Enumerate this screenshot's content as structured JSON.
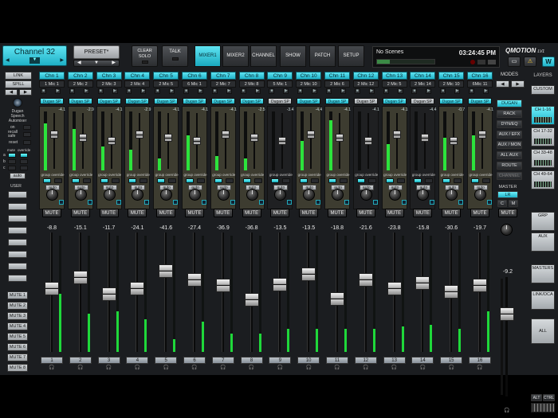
{
  "header": {
    "channel_name": "Channel 32",
    "preset_label": "PRESET*",
    "clear_solo_l1": "CLEAR",
    "clear_solo_l2": "SOLO",
    "talk_label": "TALK",
    "scene_name": "No Scenes",
    "time": "03:24:45 PM",
    "brand": "QMOTION",
    "brand_sub": "LV1"
  },
  "tabs": [
    "MIXER1",
    "MIXER2",
    "CHANNEL",
    "SHOW",
    "PATCH",
    "SETUP"
  ],
  "active_tab": "MIXER1",
  "left": {
    "link": "LINK",
    "spill": "SPILL",
    "dugan_l1": "Dugan",
    "dugan_l2": "Speech",
    "dugan_l3": "Automixer",
    "on": "on",
    "recall_l1": "recall",
    "recall_l2": "safe",
    "reset": "reset",
    "mute": "mute",
    "override": "override",
    "auto": "auto",
    "a": "a",
    "b": "b",
    "c": "c",
    "user": "USER",
    "mute_groups": [
      "MUTE 1",
      "MUTE 2",
      "MUTE 3",
      "MUTE 4",
      "MUTE 5",
      "MUTE 6",
      "MUTE 7",
      "MUTE 8"
    ]
  },
  "dugan_label": "Dugan SP",
  "group_label": "group override",
  "auto_label": "auto",
  "mute_label": "MUTE",
  "channels": [
    {
      "name": "Chn 1",
      "src": "1 Mic 1",
      "gain": "-4.1",
      "dugan_on": true,
      "fader": "-8.8",
      "fader_level": 0.7,
      "meter": 0.5,
      "dmeter": 0.8
    },
    {
      "name": "Chn 2",
      "src": "2 Mic 2",
      "gain": "-2.9",
      "dugan_on": true,
      "fader": "-15.1",
      "fader_level": 0.78,
      "meter": 0.33,
      "dmeter": 0.7
    },
    {
      "name": "Chn 3",
      "src": "2 Mic 3",
      "gain": "-4.1",
      "dugan_on": true,
      "fader": "-11.7",
      "fader_level": 0.66,
      "meter": 0.35,
      "dmeter": 0.4
    },
    {
      "name": "Chn 4",
      "src": "2 Mic 4",
      "gain": "-2.9",
      "dugan_on": true,
      "fader": "-24.1",
      "fader_level": 0.7,
      "meter": 0.28,
      "dmeter": 0.35
    },
    {
      "name": "Chn 5",
      "src": "2 Mic 5",
      "gain": "-4.1",
      "dugan_on": true,
      "fader": "-41.6",
      "fader_level": 0.82,
      "meter": 0.11,
      "dmeter": 0.2
    },
    {
      "name": "Chn 6",
      "src": "6 Mic 1",
      "gain": "-4.1",
      "dugan_on": true,
      "fader": "-27.4",
      "fader_level": 0.76,
      "meter": 0.26,
      "dmeter": 0.6
    },
    {
      "name": "Chn 7",
      "src": "2 Mic 7",
      "gain": "-4.1",
      "dugan_on": true,
      "fader": "-36.9",
      "fader_level": 0.72,
      "meter": 0.16,
      "dmeter": 0.25
    },
    {
      "name": "Chn 8",
      "src": "2 Mic 8",
      "gain": "-2.5",
      "dugan_on": true,
      "fader": "-36.8",
      "fader_level": 0.62,
      "meter": 0.16,
      "dmeter": 0.2
    },
    {
      "name": "Chn 9",
      "src": "5 Mic 1",
      "gain": "-3.4",
      "dugan_on": false,
      "fader": "-13.5",
      "fader_level": 0.73,
      "meter": 0.2,
      "dmeter": 0.0
    },
    {
      "name": "Chn 10",
      "src": "2 Mic 10",
      "gain": "-4.4",
      "dugan_on": true,
      "fader": "-13.5",
      "fader_level": 0.8,
      "meter": 0.2,
      "dmeter": 0.5
    },
    {
      "name": "Chn 11",
      "src": "2 Mic 6",
      "gain": "-4.1",
      "dugan_on": true,
      "fader": "-18.8",
      "fader_level": 0.63,
      "meter": 0.2,
      "dmeter": 0.85
    },
    {
      "name": "Chn 12",
      "src": "2 Mic 12",
      "gain": "-4.1",
      "dugan_on": false,
      "fader": "-21.6",
      "fader_level": 0.76,
      "meter": 0.2,
      "dmeter": 0.0
    },
    {
      "name": "Chn 13",
      "src": "2 Mic 5",
      "gain": "-4.1",
      "dugan_on": true,
      "fader": "-23.8",
      "fader_level": 0.7,
      "meter": 0.22,
      "dmeter": 0.45
    },
    {
      "name": "Chn 14",
      "src": "2 Mic 14",
      "gain": "-4.4",
      "dugan_on": false,
      "fader": "-15.8",
      "fader_level": 0.74,
      "meter": 0.23,
      "dmeter": 0.0
    },
    {
      "name": "Chn 15",
      "src": "2 Mic 10",
      "gain": "-0.7",
      "dugan_on": true,
      "fader": "-30.6",
      "fader_level": 0.68,
      "meter": 0.2,
      "dmeter": 0.55
    },
    {
      "name": "Chn 16",
      "src": "6Mic 11",
      "gain": "-4.1",
      "dugan_on": true,
      "fader": "-19.7",
      "fader_level": 0.72,
      "meter": 0.35,
      "dmeter": 0.6
    }
  ],
  "modes": {
    "title": "MODES",
    "items": [
      "DUGAN",
      "RACK",
      "DYN/EQ",
      "AUX / EFX",
      "AUX / MON",
      "ALL AUX",
      "ROUTE",
      "CHANNEL"
    ],
    "active": "DUGAN"
  },
  "master": {
    "title": "MASTER",
    "lr": "LR",
    "c": "C",
    "m": "M",
    "mute": "MUTE",
    "value": "-9.2",
    "fader_level": 0.8,
    "meter": 0.0
  },
  "layers": {
    "title": "LAYERS",
    "items": [
      "CUSTOM",
      "CH 1-16",
      "CH 17-32",
      "CH 33-48",
      "CH 49-64",
      "GRP",
      "AUX",
      "MASTERS",
      "LINK/DCA",
      "ALL"
    ],
    "active": "CH 1-16",
    "alt": "ALT",
    "ctrl": "CTRL"
  },
  "colors": {
    "accent": "#2ec3d8",
    "meter": "#1fd83a",
    "dugan_on_bg": "#3d3c30"
  }
}
